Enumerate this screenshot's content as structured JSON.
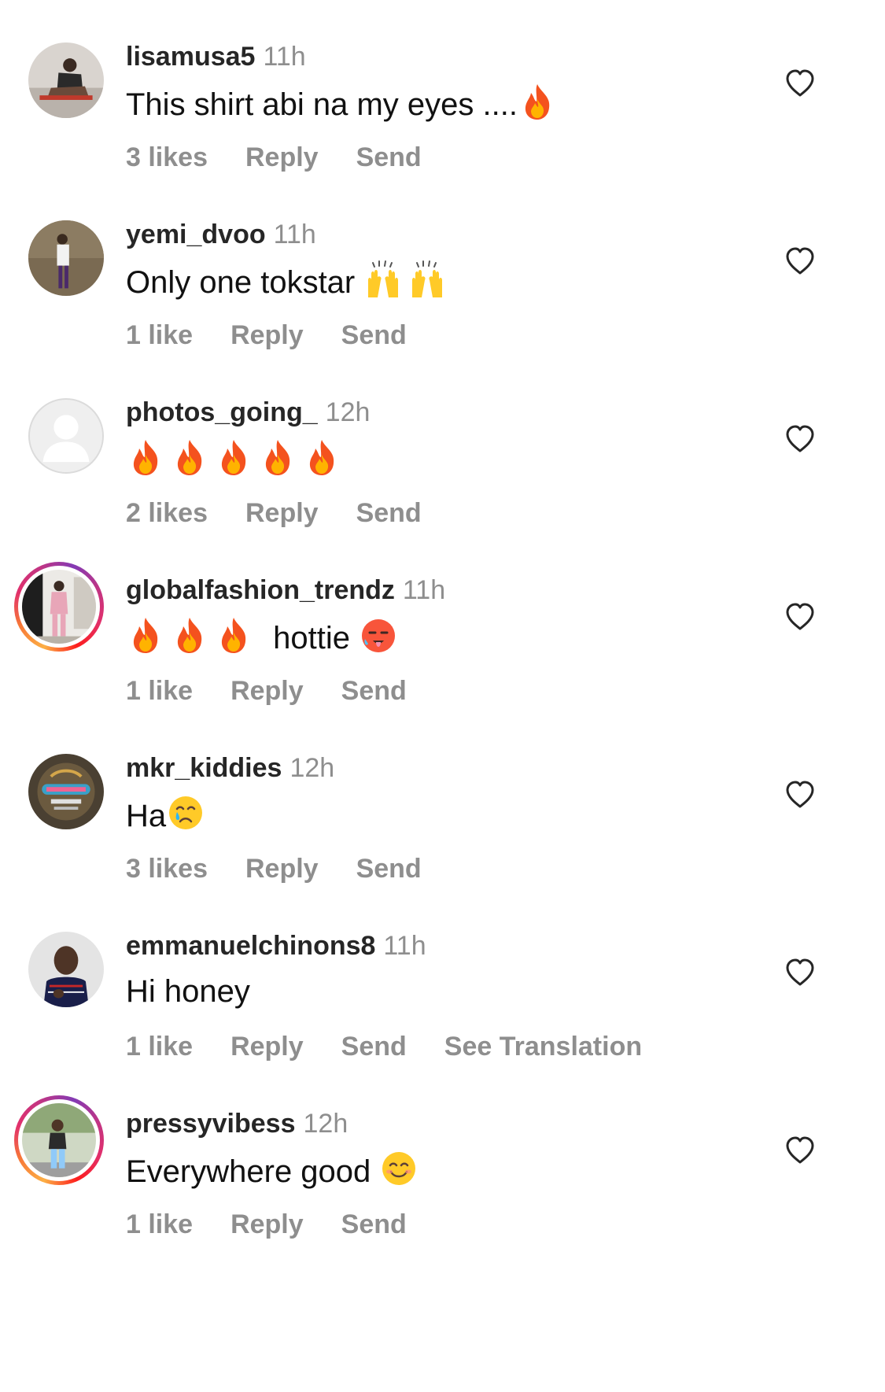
{
  "comments": [
    {
      "username": "lisamusa5",
      "time": "11h",
      "text": "This shirt abi na my eyes ....",
      "emojis": [
        "fire-emoji"
      ],
      "likes": "3 likes",
      "reply": "Reply",
      "send": "Send",
      "avatar": "photo",
      "has_story_ring": false
    },
    {
      "username": "yemi_dvoo",
      "time": "11h",
      "text": "Only one tokstar",
      "emojis": [
        "raising-hands-emoji",
        "raising-hands-emoji"
      ],
      "likes": "1 like",
      "reply": "Reply",
      "send": "Send",
      "avatar": "photo",
      "has_story_ring": false
    },
    {
      "username": "photos_going_",
      "time": "12h",
      "text": "",
      "emojis": [
        "fire-emoji",
        "fire-emoji",
        "fire-emoji",
        "fire-emoji",
        "fire-emoji"
      ],
      "likes": "2 likes",
      "reply": "Reply",
      "send": "Send",
      "avatar": "default",
      "has_story_ring": false
    },
    {
      "username": "globalfashion_trendz",
      "time": "11h",
      "text_before": "",
      "text": "hottie",
      "emojis_before": [
        "fire-emoji",
        "fire-emoji",
        "fire-emoji"
      ],
      "emojis": [
        "hot-face-emoji"
      ],
      "likes": "1 like",
      "reply": "Reply",
      "send": "Send",
      "avatar": "photo",
      "has_story_ring": true
    },
    {
      "username": "mkr_kiddies",
      "time": "12h",
      "text": "Ha",
      "emojis": [
        "crying-face-emoji"
      ],
      "likes": "3 likes",
      "reply": "Reply",
      "send": "Send",
      "avatar": "logo",
      "has_story_ring": false
    },
    {
      "username": "emmanuelchinons8",
      "time": "11h",
      "text": "Hi honey",
      "emojis": [],
      "likes": "1 like",
      "reply": "Reply",
      "send": "Send",
      "translate": "See Translation",
      "avatar": "photo",
      "has_story_ring": false
    },
    {
      "username": "pressyvibess",
      "time": "12h",
      "text": "Everywhere good",
      "emojis": [
        "smiling-face-emoji"
      ],
      "likes": "1 like",
      "reply": "Reply",
      "send": "Send",
      "avatar": "photo",
      "has_story_ring": true
    }
  ],
  "colors": {
    "username": "#262626",
    "meta": "#8e8e8e",
    "text": "#111111",
    "heart": "#262626"
  }
}
